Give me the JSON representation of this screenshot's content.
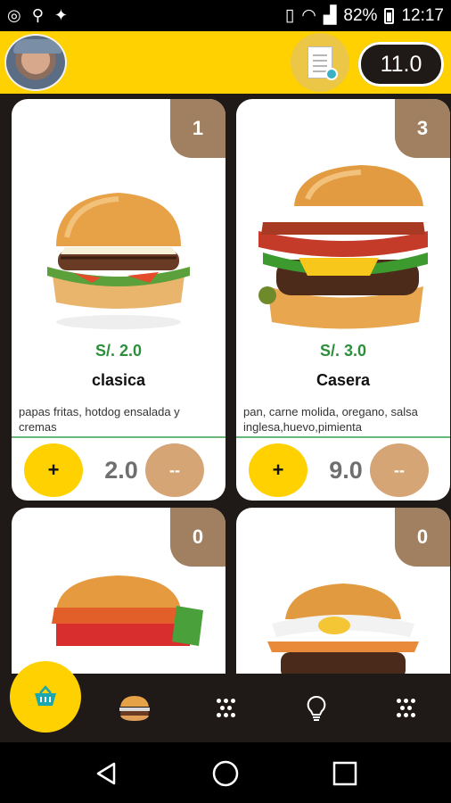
{
  "status_bar": {
    "battery": "82%",
    "time": "12:17"
  },
  "header": {
    "total": "11.0"
  },
  "products": [
    {
      "count": "1",
      "price": "S/. 2.0",
      "name": "clasica",
      "description": "papas fritas, hotdog ensalada y cremas",
      "quantity": "2.0",
      "add_label": "+",
      "remove_label": "--"
    },
    {
      "count": "3",
      "price": "S/. 3.0",
      "name": "Casera",
      "description": "pan, carne molida, oregano, salsa inglesa,huevo,pimienta",
      "quantity": "9.0",
      "add_label": "+",
      "remove_label": "--"
    },
    {
      "count": "0"
    },
    {
      "count": "0"
    }
  ],
  "colors": {
    "brand_yellow": "#ffd100",
    "brown_badge": "#a08061",
    "price_green": "#2d8f3b",
    "dark_bg": "#1f1a17"
  },
  "bottom_nav": {
    "icons": [
      "basket-icon",
      "burger-icon",
      "dots-grid-icon",
      "lightbulb-icon",
      "dots-grid-icon"
    ]
  },
  "android_nav": {
    "icons": [
      "back-icon",
      "home-icon",
      "recents-icon"
    ]
  }
}
